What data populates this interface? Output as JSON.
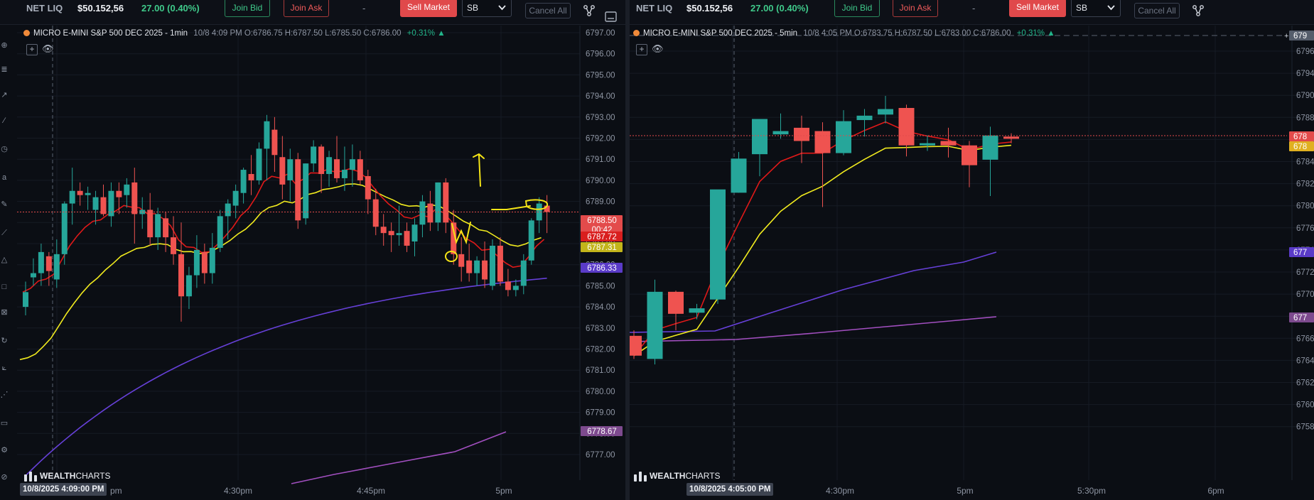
{
  "topbar1": {
    "net_liq_label": "NET LIQ",
    "net_liq_value": "$50.152,56",
    "pnl": "27.00 (0.40%)",
    "join_bid": "Join Bid",
    "join_ask": "Join Ask",
    "dash": "-",
    "sell_market": "Sell Market",
    "route": "SB",
    "cancel_all": "Cancel All"
  },
  "topbar2": {
    "net_liq_label": "NET LIQ",
    "net_liq_value": "$50.152,56",
    "pnl": "27.00 (0.40%)",
    "join_bid": "Join Bid",
    "join_ask": "Join Ask",
    "dash": "-",
    "sell_market": "Sell Market",
    "route": "SB",
    "cancel_all": "Cancel All"
  },
  "chart1_legend": {
    "symbol": "MICRO E-MINI S&P 500 DEC 2025 - 1min",
    "stats": "10/8 4:09 PM O:6786.75 H:6787.50 L:6785.50 C:6786.00",
    "change": "+0.31%"
  },
  "chart2_legend": {
    "symbol": "MICRO E-MINI S&P 500 DEC 2025 - 5min",
    "stats": "10/8 4:05 PM O:6783.75 H:6787.50 L:6783.00 C:6786.00",
    "change": "+0.31%"
  },
  "watermark": {
    "bold": "WEALTH",
    "thin": "CHARTS"
  },
  "colors": {
    "up": "#26a69a",
    "down": "#ef5350",
    "ema_fast": "#e01919",
    "ema_slow": "#f0ea1e",
    "sma_long": "#6640d8",
    "sma_vlong": "#a24fc0",
    "annotation": "#f4e416"
  },
  "chart_data": [
    {
      "type": "candlestick",
      "title": "MICRO E-MINI S&P 500 DEC 2025 - 1min",
      "ylim": [
        6776.5,
        6797.5
      ],
      "y_ticks": [
        "6797.00",
        "6796.00",
        "6795.00",
        "6794.00",
        "6793.00",
        "6792.00",
        "6791.00",
        "6790.00",
        "6789.00",
        "6788.00",
        "6787.00",
        "6786.00",
        "6785.00",
        "6784.00",
        "6783.00",
        "6782.00",
        "6781.00",
        "6780.00",
        "6779.00",
        "6778.00",
        "6777.00"
      ],
      "x_ticks": [
        "4:30pm",
        "4:45pm",
        "5pm"
      ],
      "cursor_time": "10/8/2025 4:09:00 PM",
      "price_tags": [
        {
          "label": "6788.50",
          "value": 6788.5,
          "color": "#e34b4b"
        },
        {
          "label": "00:42",
          "value": 6788.0,
          "color": "#e34b4b"
        },
        {
          "label": "6787.72",
          "value": 6787.5,
          "color": "#d91e1e"
        },
        {
          "label": "6787.31",
          "value": 6787.05,
          "color": "#c2b41a"
        },
        {
          "label": "6786.33",
          "value": 6786.33,
          "color": "#5a3bc8"
        },
        {
          "label": "6778.67",
          "value": 6778.67,
          "color": "#7d4a8e"
        }
      ],
      "last_price": 6788.5,
      "candles": [
        [
          6784.0,
          6785.2,
          6783.6,
          6784.7
        ],
        [
          6785.4,
          6786.3,
          6785.0,
          6785.6
        ],
        [
          6785.6,
          6787.0,
          6785.0,
          6786.6
        ],
        [
          6786.4,
          6786.6,
          6785.0,
          6785.7
        ],
        [
          6785.3,
          6787.2,
          6784.9,
          6786.5
        ],
        [
          6786.5,
          6789.0,
          6786.0,
          6788.9
        ],
        [
          6788.9,
          6790.6,
          6787.9,
          6789.5
        ],
        [
          6789.5,
          6789.9,
          6788.8,
          6789.3
        ],
        [
          6789.3,
          6789.7,
          6788.6,
          6789.4
        ],
        [
          6788.6,
          6789.5,
          6787.9,
          6789.2
        ],
        [
          6789.2,
          6789.8,
          6788.3,
          6788.4
        ],
        [
          6788.3,
          6789.9,
          6787.8,
          6789.5
        ],
        [
          6789.5,
          6789.9,
          6788.4,
          6789.2
        ],
        [
          6789.3,
          6790.1,
          6788.7,
          6789.8
        ],
        [
          6789.9,
          6790.6,
          6787.0,
          6788.4
        ],
        [
          6788.4,
          6789.2,
          6787.7,
          6788.6
        ],
        [
          6788.6,
          6789.4,
          6786.9,
          6787.3
        ],
        [
          6787.3,
          6788.7,
          6786.7,
          6788.4
        ],
        [
          6788.2,
          6788.5,
          6786.6,
          6787.3
        ],
        [
          6787.3,
          6788.3,
          6786.0,
          6786.5
        ],
        [
          6786.5,
          6788.0,
          6783.3,
          6784.5
        ],
        [
          6784.5,
          6785.9,
          6783.9,
          6785.5
        ],
        [
          6785.5,
          6787.4,
          6784.9,
          6786.7
        ],
        [
          6786.6,
          6787.0,
          6785.1,
          6785.6
        ],
        [
          6785.6,
          6787.5,
          6785.1,
          6786.8
        ],
        [
          6786.8,
          6788.6,
          6786.6,
          6788.3
        ],
        [
          6788.3,
          6789.1,
          6787.2,
          6788.9
        ],
        [
          6788.8,
          6789.8,
          6788.2,
          6789.5
        ],
        [
          6789.4,
          6790.6,
          6788.9,
          6790.5
        ],
        [
          6790.3,
          6791.2,
          6789.3,
          6790.0
        ],
        [
          6790.0,
          6791.8,
          6789.8,
          6791.5
        ],
        [
          6791.5,
          6793.1,
          6790.0,
          6792.8
        ],
        [
          6792.4,
          6793.0,
          6790.4,
          6791.2
        ],
        [
          6791.1,
          6792.1,
          6789.1,
          6789.8
        ],
        [
          6790.0,
          6791.5,
          6789.0,
          6791.0
        ],
        [
          6791.0,
          6791.3,
          6787.7,
          6788.1
        ],
        [
          6788.2,
          6790.8,
          6787.9,
          6790.8
        ],
        [
          6790.8,
          6791.9,
          6790.4,
          6791.6
        ],
        [
          6791.6,
          6791.7,
          6789.4,
          6790.3
        ],
        [
          6790.3,
          6791.4,
          6789.7,
          6791.1
        ],
        [
          6791.0,
          6792.1,
          6789.9,
          6790.1
        ],
        [
          6790.1,
          6791.6,
          6789.5,
          6790.5
        ],
        [
          6790.5,
          6791.7,
          6789.7,
          6791.0
        ],
        [
          6791.0,
          6791.4,
          6789.8,
          6790.0
        ],
        [
          6790.2,
          6790.5,
          6788.4,
          6789.1
        ],
        [
          6789.1,
          6789.6,
          6787.4,
          6787.8
        ],
        [
          6787.8,
          6788.4,
          6786.9,
          6787.5
        ],
        [
          6787.6,
          6788.0,
          6786.6,
          6787.4
        ],
        [
          6787.4,
          6788.8,
          6786.9,
          6787.5
        ],
        [
          6787.6,
          6788.0,
          6786.6,
          6786.9
        ],
        [
          6787.1,
          6788.2,
          6786.4,
          6787.9
        ],
        [
          6787.9,
          6789.3,
          6787.3,
          6789.0
        ],
        [
          6788.9,
          6789.5,
          6787.6,
          6788.0
        ],
        [
          6788.0,
          6789.9,
          6787.6,
          6789.9
        ],
        [
          6789.9,
          6790.1,
          6787.5,
          6788.0
        ],
        [
          6788.0,
          6788.6,
          6786.0,
          6786.5
        ],
        [
          6786.5,
          6787.3,
          6785.2,
          6785.9
        ],
        [
          6786.2,
          6787.0,
          6785.2,
          6785.6
        ],
        [
          6785.6,
          6786.4,
          6785.0,
          6786.2
        ],
        [
          6786.2,
          6787.1,
          6784.9,
          6785.3
        ],
        [
          6785.0,
          6787.2,
          6784.8,
          6786.9
        ],
        [
          6786.9,
          6787.3,
          6785.0,
          6785.2
        ],
        [
          6785.2,
          6785.8,
          6784.5,
          6784.8
        ],
        [
          6784.8,
          6785.3,
          6784.5,
          6785.0
        ],
        [
          6785.0,
          6786.5,
          6784.6,
          6786.2
        ],
        [
          6786.2,
          6788.2,
          6786.0,
          6788.1
        ],
        [
          6788.1,
          6789.2,
          6787.5,
          6788.9
        ],
        [
          6788.8,
          6789.3,
          6787.5,
          6788.5
        ]
      ]
    },
    {
      "type": "candlestick",
      "title": "MICRO E-MINI S&P 500 DEC 2025 - 5min",
      "y_ticks": [
        "6796",
        "6794",
        "6790",
        "6788",
        "6786",
        "6784",
        "6782",
        "6780",
        "6776",
        "6774",
        "6772",
        "6770",
        "6768",
        "6766",
        "6764",
        "6762",
        "6760",
        "6758"
      ],
      "x_ticks": [
        "4:30pm",
        "5pm",
        "5:30pm",
        "6pm"
      ],
      "cursor_time": "10/8/2025 4:05:00 PM",
      "price_tags": [
        {
          "label": "679",
          "color": "#555d6b"
        },
        {
          "label": "678",
          "color": "#e34b4b"
        },
        {
          "label": "678",
          "color": "#e0b020"
        },
        {
          "label": "677",
          "color": "#5a3bc8"
        },
        {
          "label": "677",
          "color": "#7d4a8e"
        }
      ],
      "candles": [
        [
          6771.3,
          6771.8,
          6769.2,
          6769.5
        ],
        [
          6769.2,
          6776.4,
          6768.7,
          6775.3
        ],
        [
          6775.3,
          6775.4,
          6771.8,
          6773.3
        ],
        [
          6773.4,
          6774.2,
          6772.8,
          6773.8
        ],
        [
          6774.6,
          6780.3,
          6774.2,
          6784.6
        ],
        [
          6784.3,
          6788.0,
          6784.3,
          6787.4
        ],
        [
          6787.8,
          6791.0,
          6785.8,
          6791.0
        ],
        [
          6789.6,
          6791.5,
          6789.2,
          6789.9
        ],
        [
          6790.2,
          6791.3,
          6787.0,
          6789.0
        ],
        [
          6789.9,
          6790.7,
          6783.0,
          6787.9
        ],
        [
          6787.9,
          6791.8,
          6787.7,
          6790.8
        ],
        [
          6790.9,
          6791.9,
          6789.4,
          6791.3
        ],
        [
          6791.4,
          6793.1,
          6790.6,
          6791.9
        ],
        [
          6792.0,
          6792.3,
          6787.6,
          6788.6
        ],
        [
          6788.6,
          6789.5,
          6788.1,
          6788.8
        ],
        [
          6789.0,
          6790.2,
          6787.5,
          6788.6
        ],
        [
          6788.6,
          6789.0,
          6784.8,
          6786.8
        ],
        [
          6787.3,
          6790.3,
          6784.0,
          6789.5
        ],
        [
          6789.4,
          6789.7,
          6788.8,
          6789.2
        ]
      ]
    }
  ]
}
